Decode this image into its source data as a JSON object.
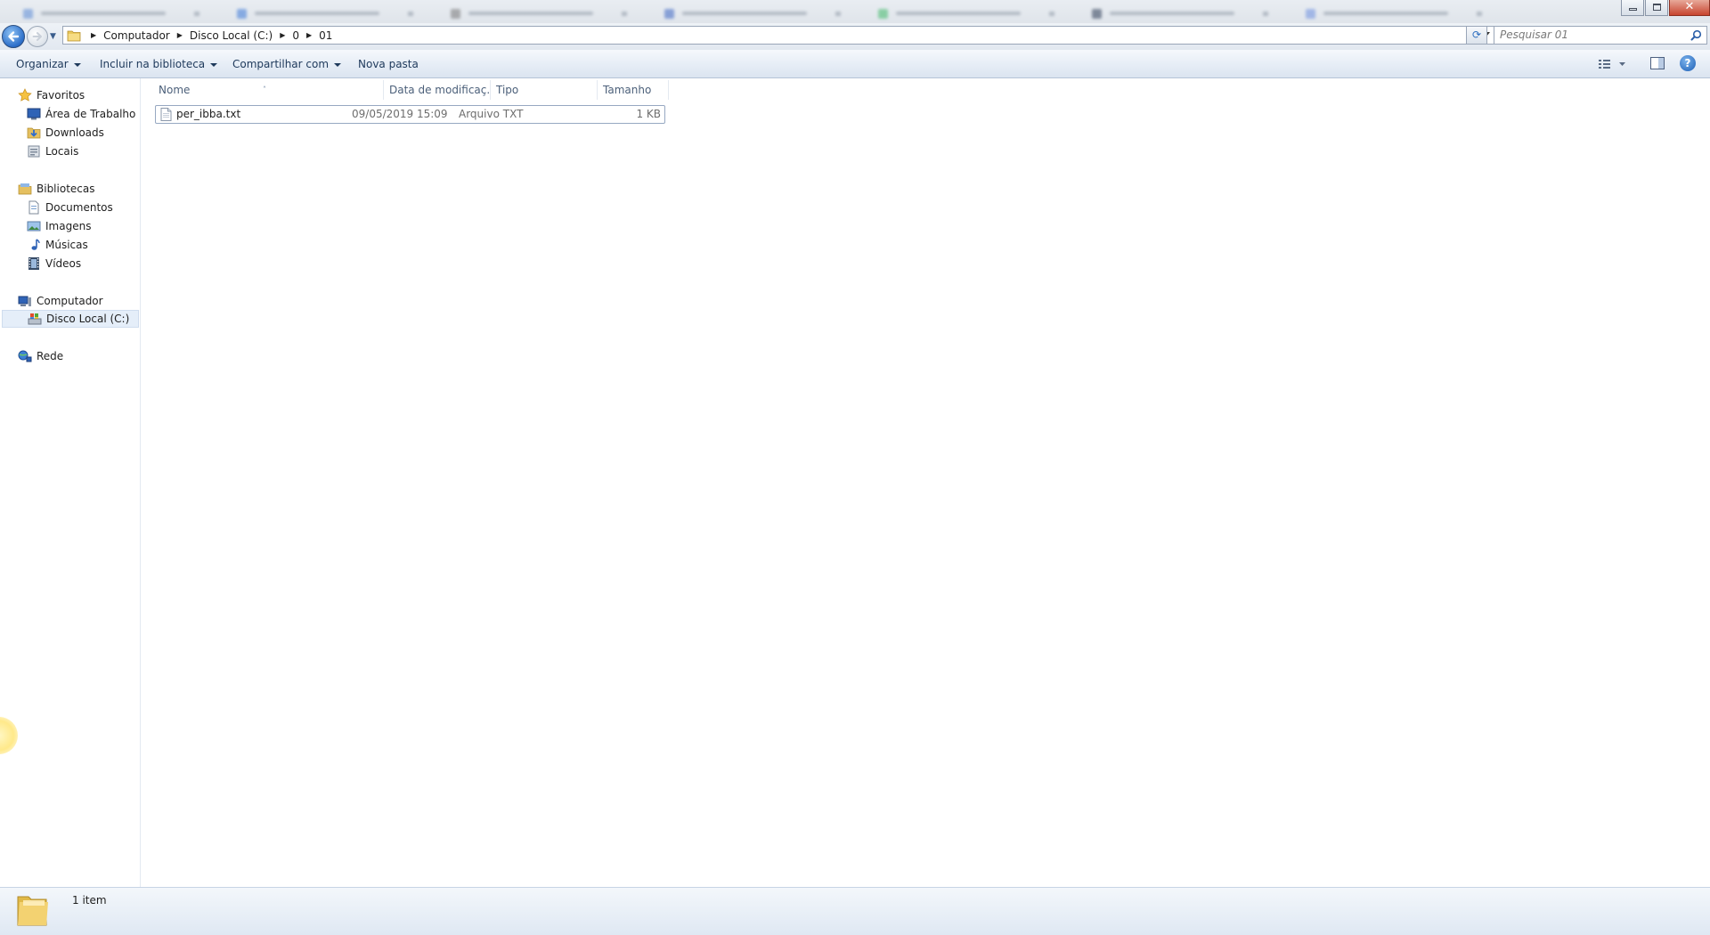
{
  "window": {
    "controls": {
      "close_glyph": "✕"
    }
  },
  "address": {
    "breadcrumbs": [
      "Computador",
      "Disco Local (C:)",
      "0",
      "01"
    ],
    "refresh_glyph": "⟳"
  },
  "search": {
    "placeholder": "Pesquisar 01",
    "value": ""
  },
  "toolbar": {
    "organize": "Organizar",
    "include_library": "Incluir na biblioteca",
    "share_with": "Compartilhar com",
    "new_folder": "Nova pasta",
    "help": "?"
  },
  "sidebar": {
    "favorites": {
      "label": "Favoritos",
      "items": [
        {
          "label": "Área de Trabalho",
          "icon": "desktop-icon"
        },
        {
          "label": "Downloads",
          "icon": "downloads-icon"
        },
        {
          "label": "Locais",
          "icon": "recent-places-icon"
        }
      ]
    },
    "libraries": {
      "label": "Bibliotecas",
      "items": [
        {
          "label": "Documentos",
          "icon": "documents-icon"
        },
        {
          "label": "Imagens",
          "icon": "pictures-icon"
        },
        {
          "label": "Músicas",
          "icon": "music-icon"
        },
        {
          "label": "Vídeos",
          "icon": "videos-icon"
        }
      ]
    },
    "computer": {
      "label": "Computador",
      "items": [
        {
          "label": "Disco Local (C:)",
          "icon": "local-disk-icon",
          "selected": true
        }
      ]
    },
    "network": {
      "label": "Rede"
    }
  },
  "file_list": {
    "columns": [
      "Nome",
      "Data de modificaç...",
      "Tipo",
      "Tamanho"
    ],
    "sort_indicator": "˄",
    "rows": [
      {
        "name": "per_ibba.txt",
        "modified": "09/05/2019 15:09",
        "type": "Arquivo TXT",
        "size": "1 KB"
      }
    ]
  },
  "status": {
    "item_count": "1 item"
  },
  "colors": {
    "accent": "#1e395b",
    "selection": "#e5eef9",
    "command_bar": "#dbe4f0"
  }
}
